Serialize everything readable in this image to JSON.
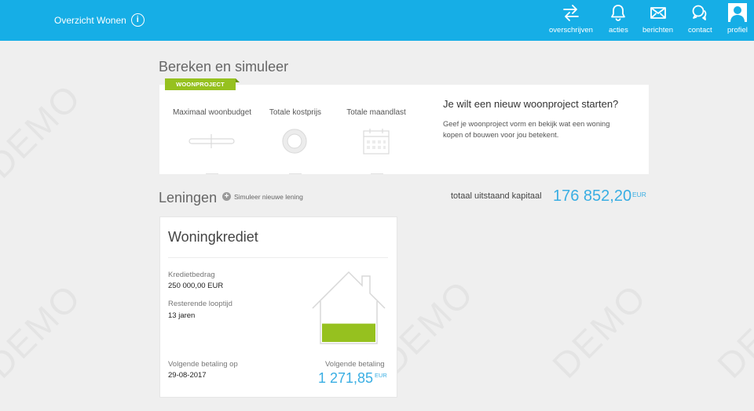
{
  "header": {
    "overview_label": "Overzicht Wonen",
    "info_glyph": "i",
    "nav": [
      {
        "label": "overschrijven",
        "icon": "transfer-arrows-icon"
      },
      {
        "label": "acties",
        "icon": "bell-icon"
      },
      {
        "label": "berichten",
        "icon": "envelope-icon"
      },
      {
        "label": "contact",
        "icon": "chat-bubbles-icon"
      },
      {
        "label": "profiel",
        "icon": "user-avatar-icon"
      }
    ]
  },
  "watermark": "DEMO",
  "simulate": {
    "title": "Bereken en simuleer",
    "ribbon": "WOONPROJECT",
    "columns": [
      {
        "label": "Maximaal woonbudget",
        "icon": "slider-icon"
      },
      {
        "label": "Totale kostprijs",
        "icon": "donut-icon"
      },
      {
        "label": "Totale maandlast",
        "icon": "calendar-icon"
      }
    ],
    "question_title": "Je wilt een nieuw woonproject starten?",
    "question_text": "Geef je woonproject vorm en bekijk wat een woning kopen of bouwen voor jou betekent."
  },
  "loans": {
    "title": "Leningen",
    "add_label": "Simuleer nieuwe lening",
    "add_glyph": "+",
    "total_label": "totaal uitstaand kapitaal",
    "total_amount": "176 852,20",
    "total_currency": "EUR"
  },
  "card": {
    "title": "Woningkrediet",
    "kredietbedrag_label": "Kredietbedrag",
    "kredietbedrag_value": "250 000,00 EUR",
    "looptijd_label": "Resterende looptijd",
    "looptijd_value": "13 jaren",
    "next_payment_date_label": "Volgende betaling op",
    "next_payment_date_value": "29-08-2017",
    "next_payment_label": "Volgende betaling",
    "next_payment_amount": "1 271,85",
    "next_payment_currency": "EUR",
    "house_fill_fraction": 0.3
  },
  "colors": {
    "header": "#16aee6",
    "accent": "#39aee3",
    "green": "#96c11f"
  }
}
